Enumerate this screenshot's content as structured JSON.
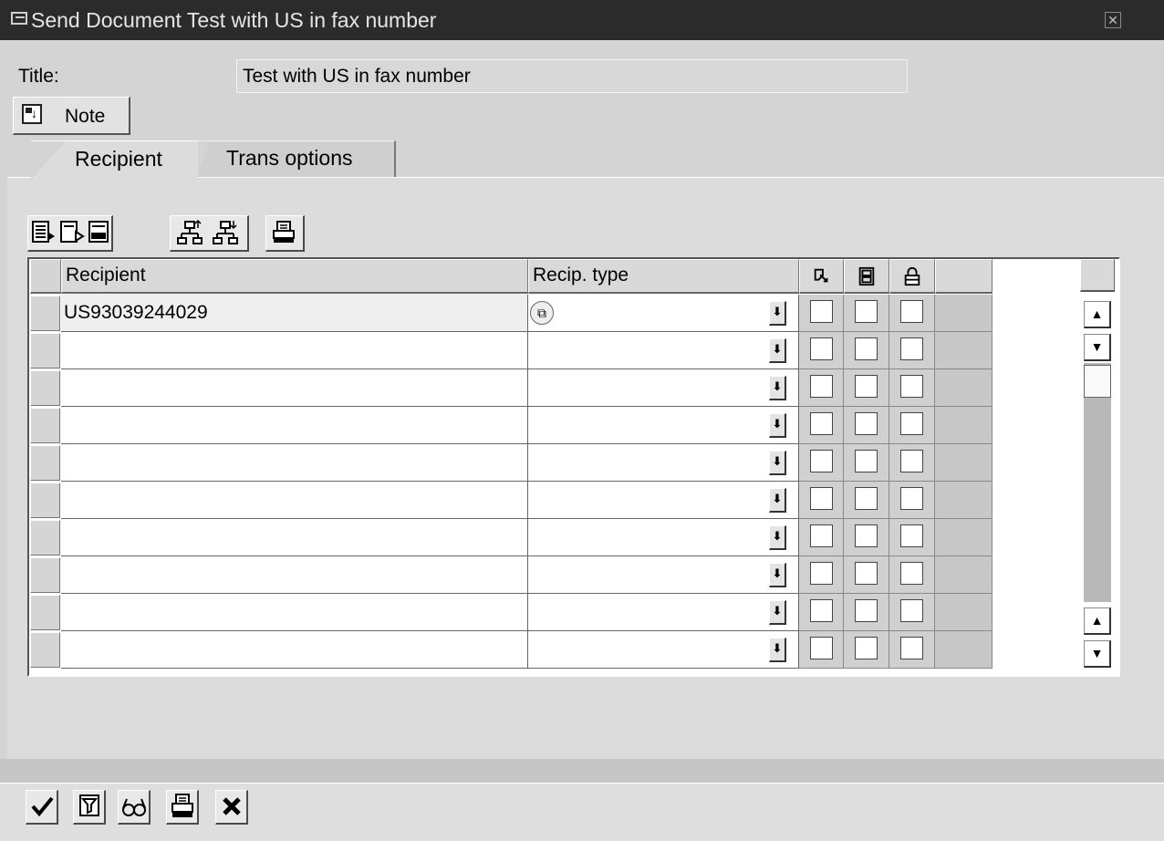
{
  "window": {
    "title": "Send Document Test with US in fax number"
  },
  "form": {
    "title_label": "Title:",
    "title_value": "Test with US in fax number"
  },
  "note_button": {
    "label": "Note"
  },
  "tabs": [
    {
      "label": "Recipient",
      "active": true
    },
    {
      "label": "Trans options",
      "active": false
    }
  ],
  "toolbar": {
    "icons": [
      "insert-row-icon",
      "append-row-icon",
      "delete-row-icon",
      "sort-ascending-icon",
      "sort-descending-icon",
      "print-icon"
    ]
  },
  "table": {
    "columns": [
      {
        "label": "Recipient"
      },
      {
        "label": "Recip. type"
      },
      {
        "icon": "express-icon"
      },
      {
        "icon": "copy-icon"
      },
      {
        "icon": "lock-icon"
      }
    ],
    "rows": [
      {
        "recipient": "US93039244029",
        "type": ""
      },
      {
        "recipient": "",
        "type": ""
      },
      {
        "recipient": "",
        "type": ""
      },
      {
        "recipient": "",
        "type": ""
      },
      {
        "recipient": "",
        "type": ""
      },
      {
        "recipient": "",
        "type": ""
      },
      {
        "recipient": "",
        "type": ""
      },
      {
        "recipient": "",
        "type": ""
      },
      {
        "recipient": "",
        "type": ""
      },
      {
        "recipient": "",
        "type": ""
      }
    ]
  },
  "bottom_buttons": [
    "confirm-icon",
    "filter-icon",
    "display-icon",
    "print-icon",
    "cancel-icon"
  ]
}
